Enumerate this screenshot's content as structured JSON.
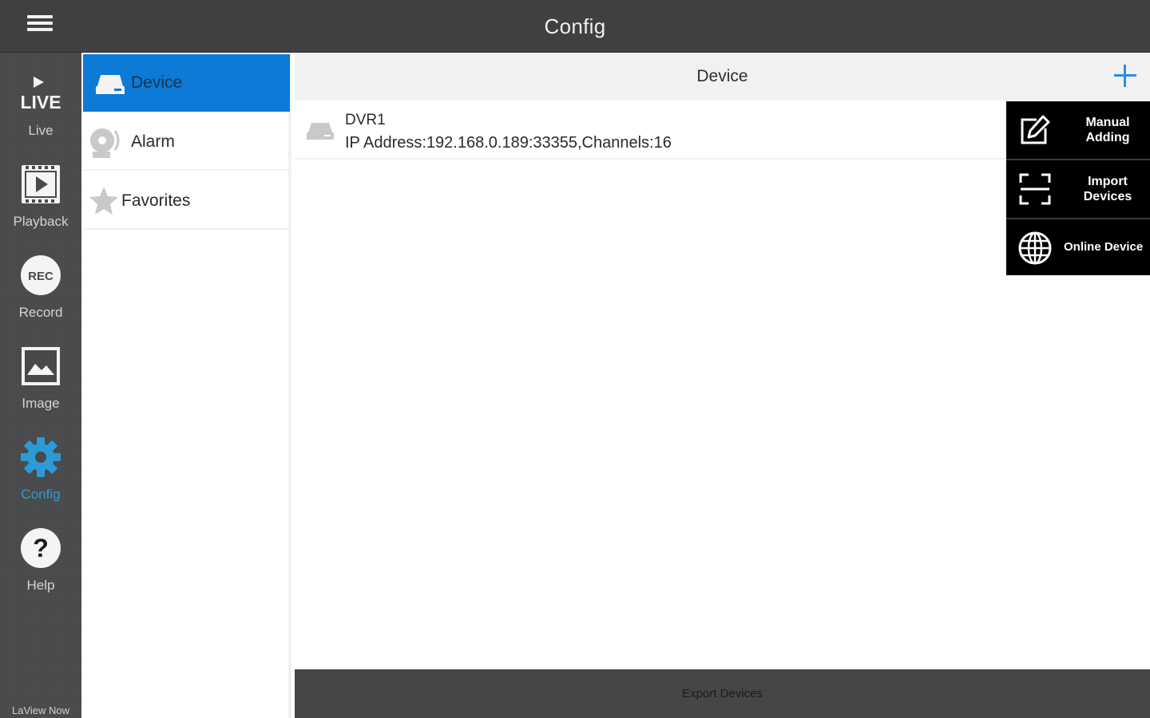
{
  "app": {
    "title": "Config",
    "brand": "LaView Now",
    "accent_color": "#2c9ad6",
    "selected_color": "#0c7ad6"
  },
  "topbar": {
    "menu_icon": "hamburger-menu-icon"
  },
  "nav": {
    "items": [
      {
        "id": "live",
        "label": "Live",
        "icon": "live-play-icon",
        "icon_text": "LIVE"
      },
      {
        "id": "playback",
        "label": "Playback",
        "icon": "playback-film-icon"
      },
      {
        "id": "record",
        "label": "Record",
        "icon": "rec-icon",
        "icon_text": "REC"
      },
      {
        "id": "image",
        "label": "Image",
        "icon": "image-icon"
      },
      {
        "id": "config",
        "label": "Config",
        "icon": "gear-icon",
        "active": true
      },
      {
        "id": "help",
        "label": "Help",
        "icon": "help-icon",
        "icon_text": "?"
      }
    ]
  },
  "submenu": {
    "items": [
      {
        "label": "Device",
        "icon": "dvr-icon",
        "active": true
      },
      {
        "label": "Alarm",
        "icon": "alarm-bell-icon"
      },
      {
        "label": "Favorites",
        "icon": "star-icon"
      }
    ]
  },
  "main": {
    "title": "Device",
    "add_icon": "plus-icon",
    "devices": [
      {
        "name": "DVR1",
        "info": "IP Address:192.168.0.189:33355,Channels:16"
      }
    ]
  },
  "popup_menu": {
    "items": [
      {
        "line1": "Manual",
        "line2": "Adding",
        "icon": "edit-icon"
      },
      {
        "line1": "Import",
        "line2": "Devices",
        "icon": "scan-frame-icon"
      },
      {
        "line1": "Online Device",
        "icon": "globe-icon"
      }
    ]
  },
  "footer": {
    "export_label": "Export Devices"
  }
}
